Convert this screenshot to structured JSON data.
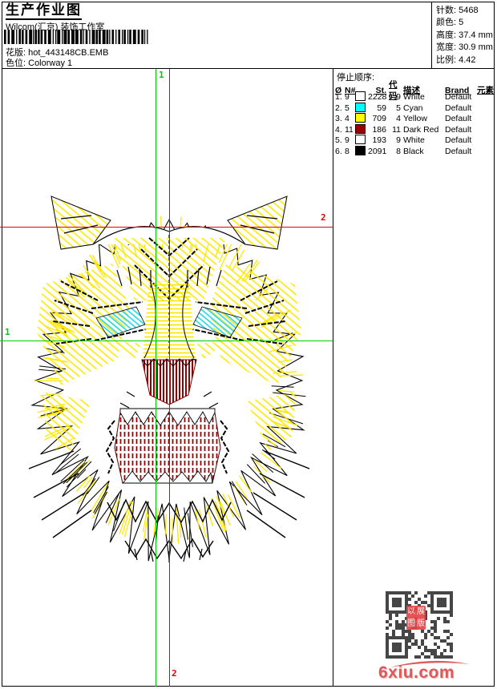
{
  "header": {
    "title": "生产作业图",
    "company": "Wilcom(汇京) 装饰工作室",
    "pattern": {
      "label": "花版:",
      "value": "hot_443148CB.EMB"
    },
    "colorway": {
      "label": "色位:",
      "value": "Colorway 1"
    }
  },
  "stats": {
    "stitches": {
      "label": "针数:",
      "value": "5468"
    },
    "colors": {
      "label": "颜色:",
      "value": "5"
    },
    "height": {
      "label": "高度:",
      "value": "37.4 mm"
    },
    "width": {
      "label": "宽度:",
      "value": "30.9 mm"
    },
    "scale": {
      "label": "比例:",
      "value": "4.42"
    }
  },
  "stop_sequence": {
    "title": "停止顺序:",
    "columns": [
      "Ø",
      "N#",
      "",
      "St.",
      "代码",
      "描述",
      "Brand",
      "元素"
    ],
    "rows": [
      {
        "seq": "1.",
        "needle": "9",
        "swatch": "#FFFFFF",
        "stitches": "2228",
        "code": "9",
        "desc": "White",
        "brand": "Default",
        "element": ""
      },
      {
        "seq": "2.",
        "needle": "5",
        "swatch": "#00FFFF",
        "stitches": "59",
        "code": "5",
        "desc": "Cyan",
        "brand": "Default",
        "element": ""
      },
      {
        "seq": "3.",
        "needle": "4",
        "swatch": "#FFFF00",
        "stitches": "709",
        "code": "4",
        "desc": "Yellow",
        "brand": "Default",
        "element": ""
      },
      {
        "seq": "4.",
        "needle": "11",
        "swatch": "#990000",
        "stitches": "186",
        "code": "11",
        "desc": "Dark Red",
        "brand": "Default",
        "element": ""
      },
      {
        "seq": "5.",
        "needle": "9",
        "swatch": "#FFFFFF",
        "stitches": "193",
        "code": "9",
        "desc": "White",
        "brand": "Default",
        "element": ""
      },
      {
        "seq": "6.",
        "needle": "8",
        "swatch": "#000000",
        "stitches": "2091",
        "code": "8",
        "desc": "Black",
        "brand": "Default",
        "element": ""
      }
    ]
  },
  "design": {
    "subject": "tiger-head-embroidery-stitchout",
    "markers": {
      "start_label": "1",
      "end_label": "2"
    },
    "guide_colors": {
      "start": "#00CC00",
      "end": "#E80000"
    },
    "palette": {
      "white": "#FFFFFF",
      "cyan": "#2BD8E6",
      "yellow": "#FFE800",
      "dark_red": "#990000",
      "black": "#000000"
    }
  },
  "watermark": {
    "logo_text": "6xiu.com",
    "logo_color": "#DC5A5A",
    "stamp_text": "以展图版",
    "stamp_color": "#E34848",
    "qr_color": "#464646"
  }
}
